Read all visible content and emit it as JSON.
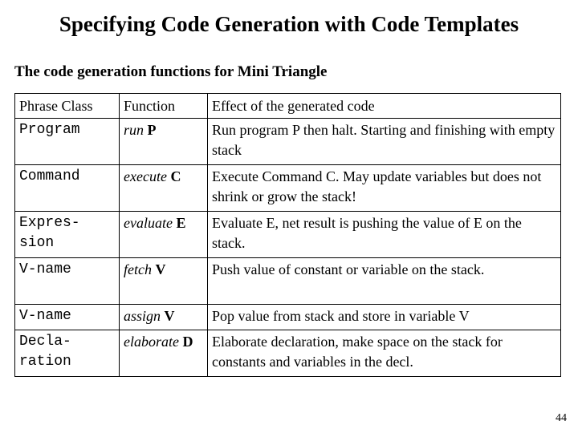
{
  "slide": {
    "title": "Specifying Code Generation with Code Templates",
    "subtitle": "The code generation functions for Mini Triangle",
    "page_number": "44"
  },
  "table": {
    "headers": {
      "phrase_class": "Phrase Class",
      "function": "Function",
      "effect": "Effect of the generated code"
    },
    "rows": [
      {
        "phrase_class": "Program",
        "function_name": "run",
        "function_arg": "P",
        "effect": "Run program P then halt. Starting and finishing with empty stack"
      },
      {
        "phrase_class": "Command",
        "function_name": "execute",
        "function_arg": "C",
        "effect": "Execute Command C. May update variables but does not shrink or grow the stack!"
      },
      {
        "phrase_class": "Expres-\nsion",
        "function_name": "evaluate",
        "function_arg": "E",
        "effect": "Evaluate E, net result is pushing the value of E on the stack."
      },
      {
        "phrase_class": "V-name",
        "function_name": "fetch",
        "function_arg": "V",
        "effect": "Push value of constant or variable on the stack."
      },
      {
        "phrase_class": "V-name",
        "function_name": "assign",
        "function_arg": "V",
        "effect": "Pop value from stack and store in variable V"
      },
      {
        "phrase_class": "Decla-\nration",
        "function_name": "elaborate",
        "function_arg": "D",
        "effect": "Elaborate declaration, make space on the stack for constants and variables in the decl."
      }
    ]
  }
}
